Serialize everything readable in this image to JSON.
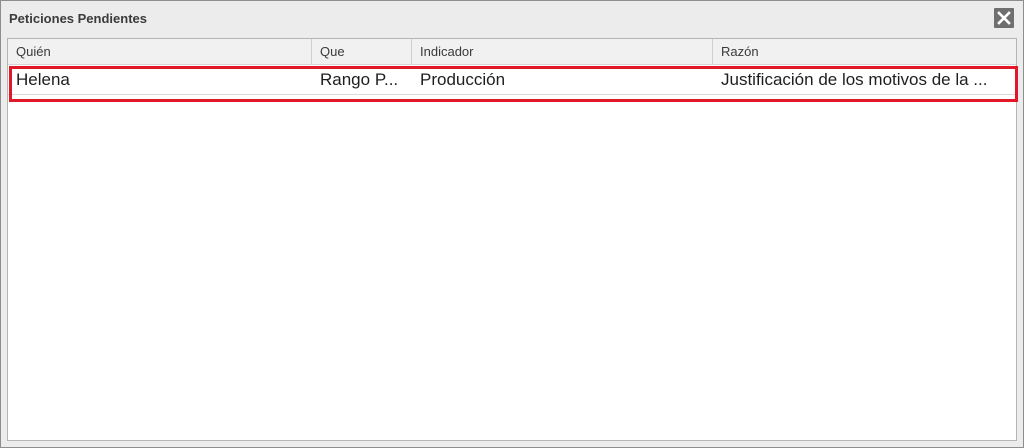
{
  "window": {
    "title": "Peticiones Pendientes"
  },
  "icons": {
    "close": "close-icon"
  },
  "colors": {
    "highlight_border": "#e0182a",
    "close_button_bg": "#6f6f6f",
    "header_bg": "#f1f1f1"
  },
  "grid": {
    "columns": [
      "Quién",
      "Que",
      "Indicador",
      "Razón"
    ],
    "rows": [
      {
        "quien": "Helena",
        "que": "Rango P...",
        "indicador": "Producción",
        "razon": "Justificación de los motivos de la ..."
      }
    ]
  }
}
